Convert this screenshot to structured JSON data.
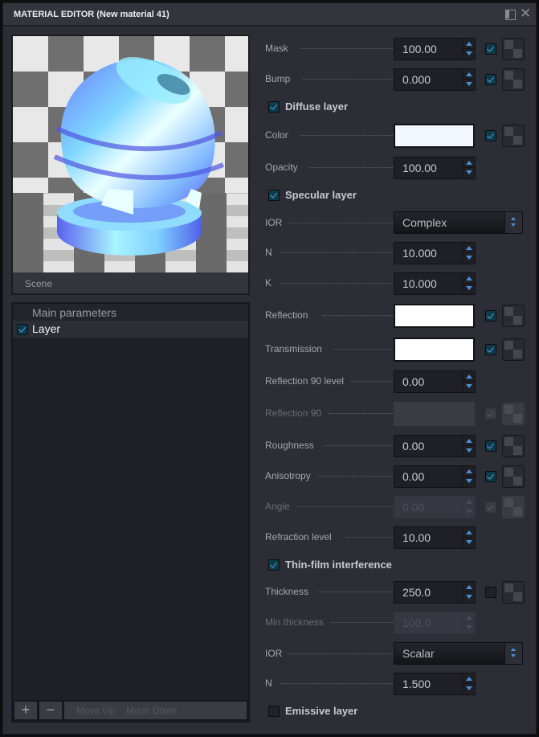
{
  "window": {
    "title": "MATERIAL EDITOR (New material 41)",
    "icons": [
      "dock-icon",
      "close-icon"
    ]
  },
  "preview": {
    "label": "Scene"
  },
  "layers": {
    "header": "Main parameters",
    "items": [
      {
        "label": "Layer",
        "checked": true
      }
    ],
    "footer": {
      "add": "+",
      "remove": "−",
      "move_up": "Move Up",
      "move_down": "Move Down"
    }
  },
  "params": {
    "mask": {
      "label": "Mask",
      "value": "100.00",
      "checked": true
    },
    "bump": {
      "label": "Bump",
      "value": "0.000",
      "checked": true
    },
    "diffuse": {
      "title": "Diffuse layer",
      "checked": true,
      "color": {
        "label": "Color",
        "swatch": "#f3f7ff",
        "checked": true
      },
      "opacity": {
        "label": "Opacity",
        "value": "100.00"
      }
    },
    "specular": {
      "title": "Specular layer",
      "checked": true,
      "ior": {
        "label": "IOR",
        "value": "Complex"
      },
      "n": {
        "label": "N",
        "value": "10.000"
      },
      "k": {
        "label": "K",
        "value": "10.000"
      },
      "reflection": {
        "label": "Reflection",
        "swatch": "#ffffff",
        "checked": true
      },
      "transmission": {
        "label": "Transmission",
        "swatch": "#ffffff",
        "checked": true
      },
      "reflection90level": {
        "label": "Reflection 90 level",
        "value": "0.00"
      },
      "reflection90": {
        "label": "Reflection 90",
        "disabled": true
      },
      "roughness": {
        "label": "Roughness",
        "value": "0.00",
        "checked": true
      },
      "anisotropy": {
        "label": "Anisotropy",
        "value": "0.00",
        "checked": true
      },
      "angle": {
        "label": "Angle",
        "value": "0.00",
        "disabled": true
      },
      "refraction_level": {
        "label": "Refraction level",
        "value": "10.00"
      }
    },
    "thinfilm": {
      "title": "Thin-film interference",
      "checked": true,
      "thickness": {
        "label": "Thickness",
        "value": "250.0",
        "checked": false
      },
      "min_thickness": {
        "label": "Min thickness",
        "value": "100.0",
        "disabled": true
      },
      "ior": {
        "label": "IOR",
        "value": "Scalar"
      },
      "n": {
        "label": "N",
        "value": "1.500"
      }
    },
    "emissive": {
      "title": "Emissive layer",
      "checked": false
    }
  },
  "colors": {
    "accent": "#4a8fd6",
    "checkbox_fill": "#0f3a4a",
    "panel_bg": "#2c2d35"
  }
}
